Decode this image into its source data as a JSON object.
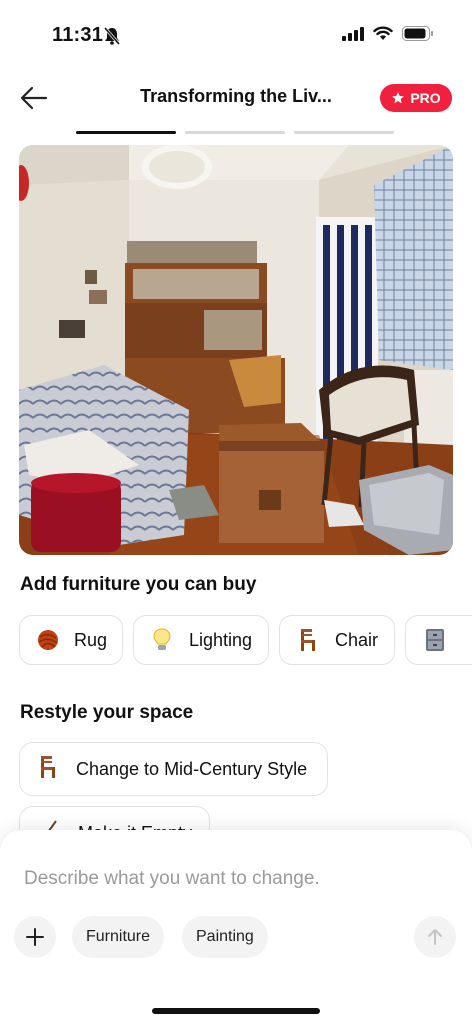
{
  "status_bar": {
    "time": "11:31"
  },
  "header": {
    "title": "Transforming the Liv...",
    "pro_label": "PRO"
  },
  "progress": {
    "steps": 3,
    "active_index": 0
  },
  "photo": {
    "alt": ""
  },
  "furniture": {
    "title": "Add furniture you can buy",
    "chips": [
      {
        "label": "Rug",
        "icon": "yarn-ball-icon"
      },
      {
        "label": "Lighting",
        "icon": "light-bulb-icon"
      },
      {
        "label": "Chair",
        "icon": "chair-icon"
      },
      {
        "label": "",
        "icon": "file-cabinet-icon"
      }
    ]
  },
  "restyle": {
    "title": "Restyle your space",
    "options": [
      {
        "label": "Change to Mid-Century Style",
        "icon": "chair-icon"
      },
      {
        "label": "Make it Empty",
        "icon": "broom-icon"
      }
    ]
  },
  "composer": {
    "placeholder": "Describe what you want to change.",
    "tags": [
      "Furniture",
      "Painting"
    ]
  },
  "colors": {
    "accent": "#f0203f",
    "text": "#111111",
    "muted": "#9a9a9a"
  }
}
